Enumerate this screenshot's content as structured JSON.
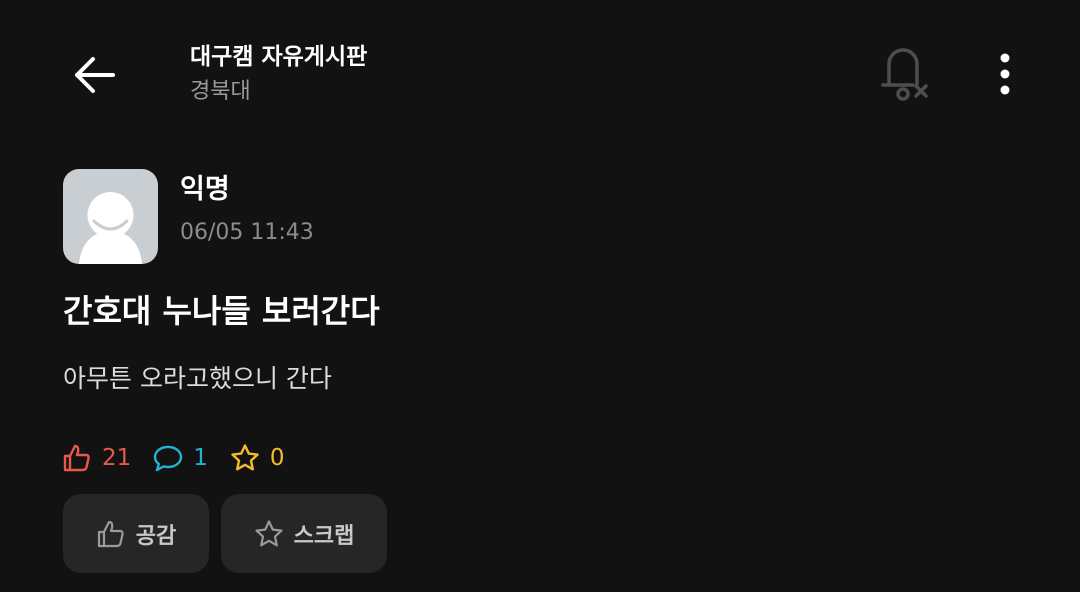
{
  "header": {
    "board_title": "대구캠 자유게시판",
    "school": "경북대",
    "back_icon": "arrow-left-icon",
    "notify_icon": "bell-off-icon",
    "more_icon": "more-vertical-icon"
  },
  "post": {
    "author": "익명",
    "time": "06/05 11:43",
    "title": "간호대 누나들 보러간다",
    "body": "아무튼 오라고했으니 간다"
  },
  "stats": {
    "likes": "21",
    "comments": "1",
    "scraps": "0",
    "like_color": "#e8584c",
    "comment_color": "#24b1d4",
    "scrap_color": "#f2bc2c"
  },
  "actions": {
    "like_label": "공감",
    "scrap_label": "스크랩"
  }
}
